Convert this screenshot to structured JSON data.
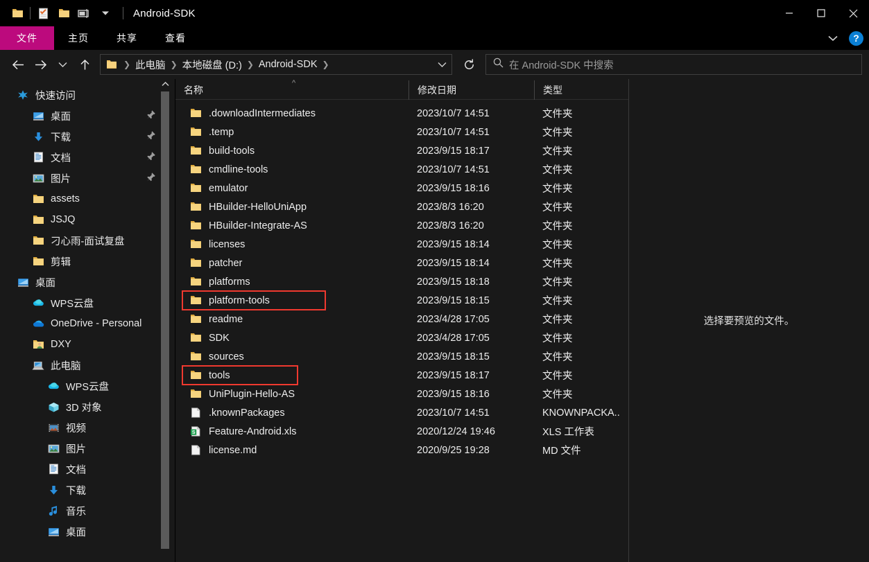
{
  "window": {
    "title": "Android-SDK",
    "quick_access": [
      {
        "name": "folder-icon",
        "label": "文件资源管理器"
      },
      {
        "name": "properties-icon",
        "label": "属性"
      },
      {
        "name": "new-folder-icon",
        "label": "新建文件夹"
      },
      {
        "name": "customize-qat-icon",
        "label": "自定义快速访问工具栏"
      }
    ],
    "controls": {
      "minimize": "—",
      "maximize": "□",
      "close": "✕"
    }
  },
  "ribbon": {
    "tabs": [
      {
        "label": "文件",
        "active": true
      },
      {
        "label": "主页",
        "active": false
      },
      {
        "label": "共享",
        "active": false
      },
      {
        "label": "查看",
        "active": false
      }
    ],
    "expand_label": "展开功能区",
    "help_label": "?",
    "accent_color": "#BC0A7D"
  },
  "nav": {
    "back": "←",
    "forward": "→",
    "recent": "⌄",
    "up": "↑",
    "breadcrumbs": [
      "此电脑",
      "本地磁盘 (D:)",
      "Android-SDK"
    ],
    "dropdown": "⌄",
    "refresh": "↻"
  },
  "search": {
    "placeholder": "在 Android-SDK 中搜索",
    "icon": "search-icon"
  },
  "sidebar": {
    "items": [
      {
        "label": "快速访问",
        "icon": "star-icon",
        "level": 0,
        "pinned": false
      },
      {
        "label": "桌面",
        "icon": "desktop-icon",
        "level": 1,
        "pinned": true
      },
      {
        "label": "下载",
        "icon": "download-icon",
        "level": 1,
        "pinned": true
      },
      {
        "label": "文档",
        "icon": "document-icon",
        "level": 1,
        "pinned": true
      },
      {
        "label": "图片",
        "icon": "pictures-icon",
        "level": 1,
        "pinned": true
      },
      {
        "label": "assets",
        "icon": "folder-icon",
        "level": 1,
        "pinned": false
      },
      {
        "label": "JSJQ",
        "icon": "folder-icon",
        "level": 1,
        "pinned": false
      },
      {
        "label": "刁心雨-面试复盘",
        "icon": "folder-icon",
        "level": 1,
        "pinned": false
      },
      {
        "label": "剪辑",
        "icon": "folder-icon",
        "level": 1,
        "pinned": false
      },
      {
        "label": "桌面",
        "icon": "desktop-icon",
        "level": 0,
        "pinned": false
      },
      {
        "label": "WPS云盘",
        "icon": "wps-cloud-icon",
        "level": 1,
        "pinned": false
      },
      {
        "label": "OneDrive - Personal",
        "icon": "onedrive-icon",
        "level": 1,
        "pinned": false
      },
      {
        "label": "DXY",
        "icon": "user-folder-icon",
        "level": 1,
        "pinned": false
      },
      {
        "label": "此电脑",
        "icon": "this-pc-icon",
        "level": 1,
        "pinned": false
      },
      {
        "label": "WPS云盘",
        "icon": "wps-cloud-icon",
        "level": 2,
        "pinned": false
      },
      {
        "label": "3D 对象",
        "icon": "3d-objects-icon",
        "level": 2,
        "pinned": false
      },
      {
        "label": "视频",
        "icon": "videos-icon",
        "level": 2,
        "pinned": false
      },
      {
        "label": "图片",
        "icon": "pictures-icon",
        "level": 2,
        "pinned": false
      },
      {
        "label": "文档",
        "icon": "document-icon",
        "level": 2,
        "pinned": false
      },
      {
        "label": "下载",
        "icon": "download-icon",
        "level": 2,
        "pinned": false
      },
      {
        "label": "音乐",
        "icon": "music-icon",
        "level": 2,
        "pinned": false
      },
      {
        "label": "桌面",
        "icon": "desktop-icon",
        "level": 2,
        "pinned": false
      }
    ]
  },
  "filelist": {
    "columns": [
      "名称",
      "修改日期",
      "类型"
    ],
    "sort_indicator": "^",
    "rows": [
      {
        "name": ".downloadIntermediates",
        "date": "2023/10/7 14:51",
        "type": "文件夹",
        "icon": "folder-icon",
        "highlight": false
      },
      {
        "name": ".temp",
        "date": "2023/10/7 14:51",
        "type": "文件夹",
        "icon": "folder-icon",
        "highlight": false
      },
      {
        "name": "build-tools",
        "date": "2023/9/15 18:17",
        "type": "文件夹",
        "icon": "folder-icon",
        "highlight": false
      },
      {
        "name": "cmdline-tools",
        "date": "2023/10/7 14:51",
        "type": "文件夹",
        "icon": "folder-icon",
        "highlight": false
      },
      {
        "name": "emulator",
        "date": "2023/9/15 18:16",
        "type": "文件夹",
        "icon": "folder-icon",
        "highlight": false
      },
      {
        "name": "HBuilder-HelloUniApp",
        "date": "2023/8/3 16:20",
        "type": "文件夹",
        "icon": "folder-icon",
        "highlight": false
      },
      {
        "name": "HBuilder-Integrate-AS",
        "date": "2023/8/3 16:20",
        "type": "文件夹",
        "icon": "folder-icon",
        "highlight": false
      },
      {
        "name": "licenses",
        "date": "2023/9/15 18:14",
        "type": "文件夹",
        "icon": "folder-icon",
        "highlight": false
      },
      {
        "name": "patcher",
        "date": "2023/9/15 18:14",
        "type": "文件夹",
        "icon": "folder-icon",
        "highlight": false
      },
      {
        "name": "platforms",
        "date": "2023/9/15 18:18",
        "type": "文件夹",
        "icon": "folder-icon",
        "highlight": false
      },
      {
        "name": "platform-tools",
        "date": "2023/9/15 18:15",
        "type": "文件夹",
        "icon": "folder-icon",
        "highlight": "platform"
      },
      {
        "name": "readme",
        "date": "2023/4/28 17:05",
        "type": "文件夹",
        "icon": "folder-icon",
        "highlight": false
      },
      {
        "name": "SDK",
        "date": "2023/4/28 17:05",
        "type": "文件夹",
        "icon": "folder-icon",
        "highlight": false
      },
      {
        "name": "sources",
        "date": "2023/9/15 18:15",
        "type": "文件夹",
        "icon": "folder-icon",
        "highlight": false
      },
      {
        "name": "tools",
        "date": "2023/9/15 18:17",
        "type": "文件夹",
        "icon": "folder-icon",
        "highlight": "tools"
      },
      {
        "name": "UniPlugin-Hello-AS",
        "date": "2023/9/15 18:16",
        "type": "文件夹",
        "icon": "folder-icon",
        "highlight": false
      },
      {
        "name": ".knownPackages",
        "date": "2023/10/7 14:51",
        "type": "KNOWNPACKA..",
        "icon": "file-icon",
        "highlight": false
      },
      {
        "name": "Feature-Android.xls",
        "date": "2020/12/24 19:46",
        "type": "XLS 工作表",
        "icon": "spreadsheet-icon",
        "highlight": false
      },
      {
        "name": "license.md",
        "date": "2020/9/25 19:28",
        "type": "MD 文件",
        "icon": "file-icon",
        "highlight": false
      }
    ],
    "highlight_color": "#F0392F"
  },
  "preview": {
    "empty_text": "选择要预览的文件。"
  }
}
